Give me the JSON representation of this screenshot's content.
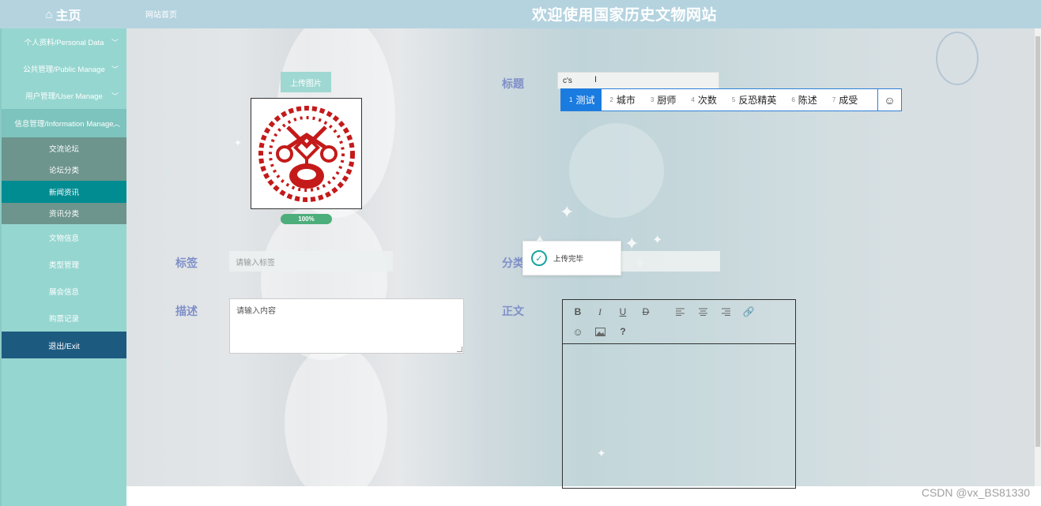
{
  "header": {
    "home_label": "主页",
    "breadcrumb": "网站首页",
    "site_title": "欢迎使用国家历史文物网站"
  },
  "sidebar": {
    "groups": [
      {
        "label": "个人资料/Personal Data"
      },
      {
        "label": "公共管理/Public Manage"
      },
      {
        "label": "用户管理/User Manage"
      },
      {
        "label": "信息管理/Information Manage"
      }
    ],
    "submenu": [
      {
        "label": "交流论坛"
      },
      {
        "label": "论坛分类"
      },
      {
        "label": "新闻资讯"
      },
      {
        "label": "资讯分类"
      }
    ],
    "items": [
      {
        "label": "文物信息"
      },
      {
        "label": "类型管理"
      },
      {
        "label": "展会信息"
      },
      {
        "label": "购票记录"
      }
    ],
    "logout": "退出/Exit"
  },
  "form": {
    "upload_button": "上传图片",
    "progress": "100%",
    "title_label": "标题",
    "title_value": "c's",
    "tags_label": "标签",
    "tags_placeholder": "请输入标签",
    "category_label": "分类",
    "desc_label": "描述",
    "desc_placeholder": "请输入内容",
    "body_label": "正文"
  },
  "ime": {
    "candidates": [
      {
        "num": "1",
        "text": "测试"
      },
      {
        "num": "2",
        "text": "城市"
      },
      {
        "num": "3",
        "text": "厨师"
      },
      {
        "num": "4",
        "text": "次数"
      },
      {
        "num": "5",
        "text": "反恐精英"
      },
      {
        "num": "6",
        "text": "陈述"
      },
      {
        "num": "7",
        "text": "成受"
      }
    ],
    "emoji": "☺"
  },
  "toast": {
    "message": "上传完毕"
  },
  "editor": {
    "toolbar": [
      "B",
      "I",
      "U",
      "D",
      "left-align",
      "center-align",
      "right-align",
      "link",
      "emoji",
      "image",
      "?"
    ]
  },
  "watermark": "CSDN @vx_BS81330",
  "colors": {
    "sidebar": "#96d6d0",
    "submenu": "#6d958d",
    "current": "#008c91",
    "logout": "#1d5a80",
    "label": "#7f8fc8"
  }
}
